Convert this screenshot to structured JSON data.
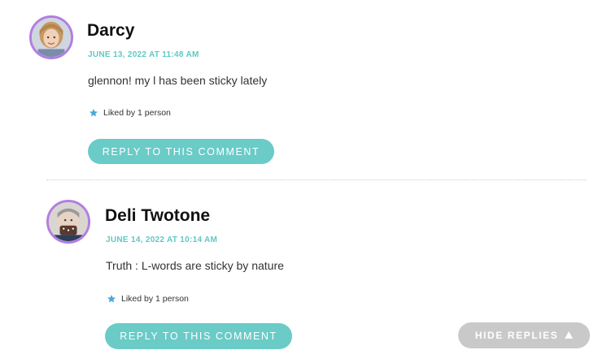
{
  "comments": [
    {
      "author": "Darcy",
      "timestamp": "JUNE 13, 2022 AT 11:48 AM",
      "text": "glennon! my l has been sticky lately",
      "likes": "Liked by 1 person",
      "reply_label": "REPLY TO THIS COMMENT",
      "icon": "star-icon"
    },
    {
      "author": "Deli Twotone",
      "timestamp": "JUNE 14, 2022 AT 10:14 AM",
      "text": "Truth : L-words are sticky by nature",
      "likes": "Liked by 1 person",
      "reply_label": "REPLY TO THIS COMMENT",
      "icon": "star-icon"
    }
  ],
  "hide_replies_label": "HIDE REPLIES",
  "colors": {
    "accent": "#6acbc7",
    "timestamp": "#5fc8c4",
    "avatar_border": "#b27ee0",
    "hide_replies_bg": "#c9c9c9",
    "star": "#4aa8d8"
  }
}
